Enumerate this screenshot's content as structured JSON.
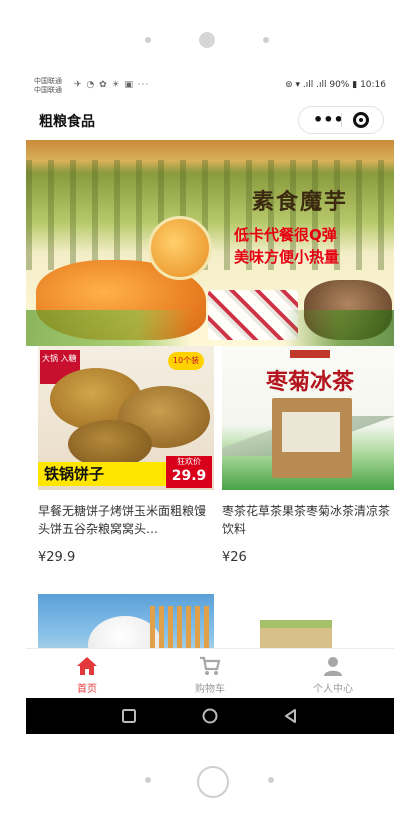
{
  "status_bar": {
    "carrier_1": "中国联通",
    "carrier_2": "中国联通",
    "icons": "✈ ◔ ✿ ☀ ▣ ···",
    "right_text": "⊚ ▾ .ıll .ıll 90% 10:16",
    "battery": "90%",
    "time": "10:16"
  },
  "app": {
    "title": "粗粮食品",
    "capsule_more": "•••",
    "capsule_close_icon": "target-icon"
  },
  "banner": {
    "calligraphy": "素食魔芋",
    "slogan_1": "低卡代餐很Q弹",
    "slogan_2": "美味方便小热量"
  },
  "products": [
    {
      "title": "早餐无糖饼子烤饼玉米面粗粮馒头饼五谷杂粮窝窝头…",
      "price": "¥29.9",
      "image": {
        "corner_tag": "大锅\n入糖",
        "count_badge": "10个装",
        "name_bar": "铁锅饼子",
        "price_tag_label": "狂欢价",
        "price_tag_value": "29.9"
      }
    },
    {
      "title": "枣茶花草茶果茶枣菊冰茶清凉茶饮料",
      "price": "¥26",
      "image": {
        "headline": "枣菊冰茶"
      }
    },
    {
      "title": "",
      "price": "",
      "image": {}
    },
    {
      "title": "",
      "price": "",
      "image": {}
    }
  ],
  "tabbar": {
    "items": [
      {
        "label": "首页",
        "icon": "home-icon",
        "active": true
      },
      {
        "label": "购物车",
        "icon": "cart-icon",
        "active": false
      },
      {
        "label": "个人中心",
        "icon": "user-icon",
        "active": false
      }
    ]
  },
  "system_nav": {
    "icons": [
      "recent-apps-icon",
      "home-circle-icon",
      "back-icon"
    ]
  },
  "colors": {
    "accent": "#e4393c",
    "tab_inactive": "#9a9a9a",
    "price_red": "#d9001b"
  }
}
